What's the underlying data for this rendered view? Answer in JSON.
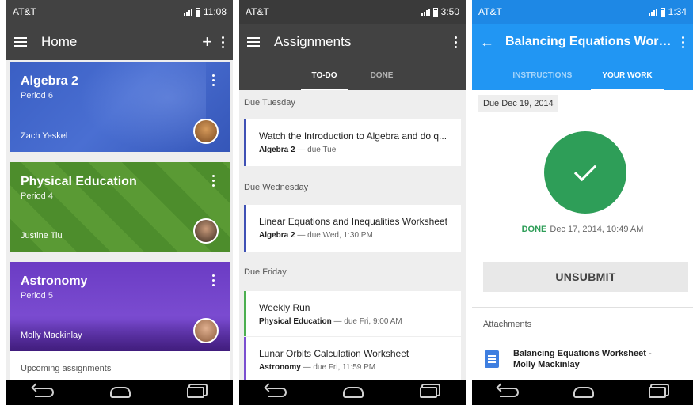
{
  "phone_home": {
    "status": {
      "carrier": "AT&T",
      "time": "11:08"
    },
    "appbar": {
      "title": "Home"
    },
    "classes": [
      {
        "name": "Algebra 2",
        "period": "Period 6",
        "teacher": "Zach Yeskel",
        "color": "#3a5fc4"
      },
      {
        "name": "Physical Education",
        "period": "Period 4",
        "teacher": "Justine Tiu",
        "color": "#4d8d2c"
      },
      {
        "name": "Astronomy",
        "period": "Period 5",
        "teacher": "Molly Mackinlay",
        "color": "#6b3cc4"
      }
    ],
    "upcoming_label": "Upcoming assignments"
  },
  "phone_assignments": {
    "status": {
      "carrier": "AT&T",
      "time": "3:50"
    },
    "appbar": {
      "title": "Assignments"
    },
    "tabs": [
      "TO-DO",
      "DONE"
    ],
    "groups": [
      {
        "header": "Due Tuesday",
        "items": [
          {
            "title": "Watch the Introduction to Algebra and do q...",
            "class": "Algebra 2",
            "due": "due Tue"
          }
        ]
      },
      {
        "header": "Due Wednesday",
        "items": [
          {
            "title": "Linear Equations and Inequalities Worksheet",
            "class": "Algebra 2",
            "due": "due Wed, 1:30 PM"
          }
        ]
      },
      {
        "header": "Due Friday",
        "items": [
          {
            "title": "Weekly Run",
            "class": "Physical Education",
            "due": "due Fri, 9:00 AM"
          },
          {
            "title": "Lunar Orbits Calculation Worksheet",
            "class": "Astronomy",
            "due": "due Fri, 11:59 PM"
          }
        ]
      }
    ],
    "dash": "—"
  },
  "phone_work": {
    "status": {
      "carrier": "AT&T",
      "time": "1:34"
    },
    "appbar": {
      "title": "Balancing Equations Works..."
    },
    "tabs": [
      "INSTRUCTIONS",
      "YOUR WORK"
    ],
    "due_date": "Due Dec 19, 2014",
    "done_label": "DONE",
    "done_time": "Dec 17, 2014, 10:49 AM",
    "unsubmit_label": "UNSUBMIT",
    "attachments_label": "Attachments",
    "attachment_name": "Balancing Equations Worksheet - Molly Mackinlay",
    "accent": "#2196f3",
    "done_color": "#2e9e58"
  }
}
